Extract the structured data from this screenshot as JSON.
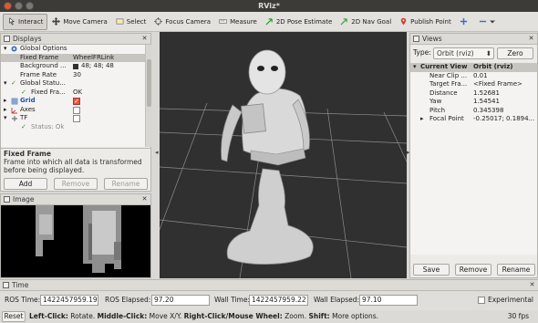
{
  "window": {
    "title": "RViz*"
  },
  "toolbar": {
    "items": [
      {
        "label": "Interact",
        "icon": "interact-icon"
      },
      {
        "label": "Move Camera",
        "icon": "move-camera-icon"
      },
      {
        "label": "Select",
        "icon": "select-icon"
      },
      {
        "label": "Focus Camera",
        "icon": "focus-camera-icon"
      },
      {
        "label": "Measure",
        "icon": "measure-icon"
      },
      {
        "label": "2D Pose Estimate",
        "icon": "pose-estimate-icon"
      },
      {
        "label": "2D Nav Goal",
        "icon": "nav-goal-icon"
      },
      {
        "label": "Publish Point",
        "icon": "publish-point-icon"
      }
    ],
    "active_index": 0
  },
  "displays": {
    "title": "Displays",
    "global_options": "Global Options",
    "fixed_frame_label": "Fixed Frame",
    "fixed_frame_value": "WheelFRLink",
    "background_label": "Background ...",
    "background_value": "48; 48; 48",
    "frame_rate_label": "Frame Rate",
    "frame_rate_value": "30",
    "global_status_label": "Global Statu...",
    "fixed_frame_status_label": "Fixed Fra...",
    "fixed_frame_status_value": "OK",
    "grid_label": "Grid",
    "axes_label": "Axes",
    "tf_label": "TF",
    "status_label": "Status: Ok",
    "description_title": "Fixed Frame",
    "description_text": "Frame into which all data is transformed before being displayed.",
    "add_button": "Add",
    "remove_button": "Remove",
    "rename_button": "Rename",
    "grid_checked": true,
    "axes_checked": false,
    "tf_checked": false
  },
  "image_panel": {
    "title": "Image"
  },
  "views": {
    "title": "Views",
    "type_label": "Type:",
    "type_value": "Orbit (rviz)",
    "zero_button": "Zero",
    "current_view_label": "Current View",
    "current_view_value": "Orbit (rviz)",
    "rows": [
      {
        "label": "Near Clip ...",
        "value": "0.01"
      },
      {
        "label": "Target Fra...",
        "value": "<Fixed Frame>"
      },
      {
        "label": "Distance",
        "value": "1.52681"
      },
      {
        "label": "Yaw",
        "value": "1.54541"
      },
      {
        "label": "Pitch",
        "value": "0.345398"
      },
      {
        "label": "Focal Point",
        "value": "-0.25017; 0.1894..."
      }
    ],
    "save_button": "Save",
    "remove_button": "Remove",
    "rename_button": "Rename"
  },
  "time": {
    "title": "Time",
    "ros_time_label": "ROS Time:",
    "ros_time_value": "1422457959.19",
    "ros_elapsed_label": "ROS Elapsed:",
    "ros_elapsed_value": "97.20",
    "wall_time_label": "Wall Time:",
    "wall_time_value": "1422457959.22",
    "wall_elapsed_label": "Wall Elapsed:",
    "wall_elapsed_value": "97.10",
    "experimental_label": "Experimental"
  },
  "status": {
    "reset_button": "Reset",
    "left_click": "Left-Click:",
    "left_click_desc": "Rotate.",
    "middle_click": "Middle-Click:",
    "middle_click_desc": "Move X/Y.",
    "right_click": "Right-Click/Mouse Wheel:",
    "right_click_desc": "Zoom.",
    "shift": "Shift:",
    "shift_desc": "More options.",
    "fps": "30 fps"
  },
  "colors": {
    "grid_check": "#e25d33",
    "display_icon": "#3c6fbf",
    "ok_check": "#3a8a2a"
  }
}
